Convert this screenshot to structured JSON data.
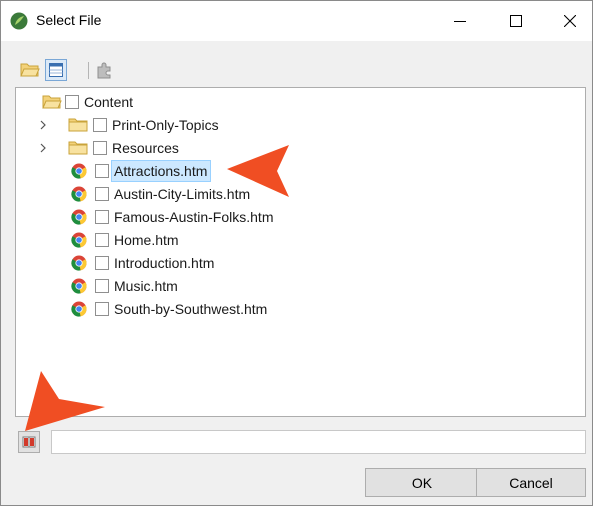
{
  "window": {
    "title": "Select File"
  },
  "toolbar": {
    "icons": [
      "open-folder-icon",
      "table-view-icon",
      "puzzle-icon"
    ]
  },
  "tree": {
    "root": {
      "label": "Content",
      "icon": "open-folder-icon"
    },
    "folders": [
      {
        "label": "Print-Only-Topics",
        "icon": "folder-icon"
      },
      {
        "label": "Resources",
        "icon": "folder-icon"
      }
    ],
    "files": [
      {
        "label": "Attractions.htm",
        "selected": true
      },
      {
        "label": "Austin-City-Limits.htm",
        "selected": false
      },
      {
        "label": "Famous-Austin-Folks.htm",
        "selected": false
      },
      {
        "label": "Home.htm",
        "selected": false
      },
      {
        "label": "Introduction.htm",
        "selected": false
      },
      {
        "label": "Music.htm",
        "selected": false
      },
      {
        "label": "South-by-Southwest.htm",
        "selected": false
      }
    ]
  },
  "bottom": {
    "path_value": ""
  },
  "buttons": {
    "ok": "OK",
    "cancel": "Cancel"
  },
  "colors": {
    "accent_pointer": "#f04e23",
    "selection": "#cce8ff"
  }
}
